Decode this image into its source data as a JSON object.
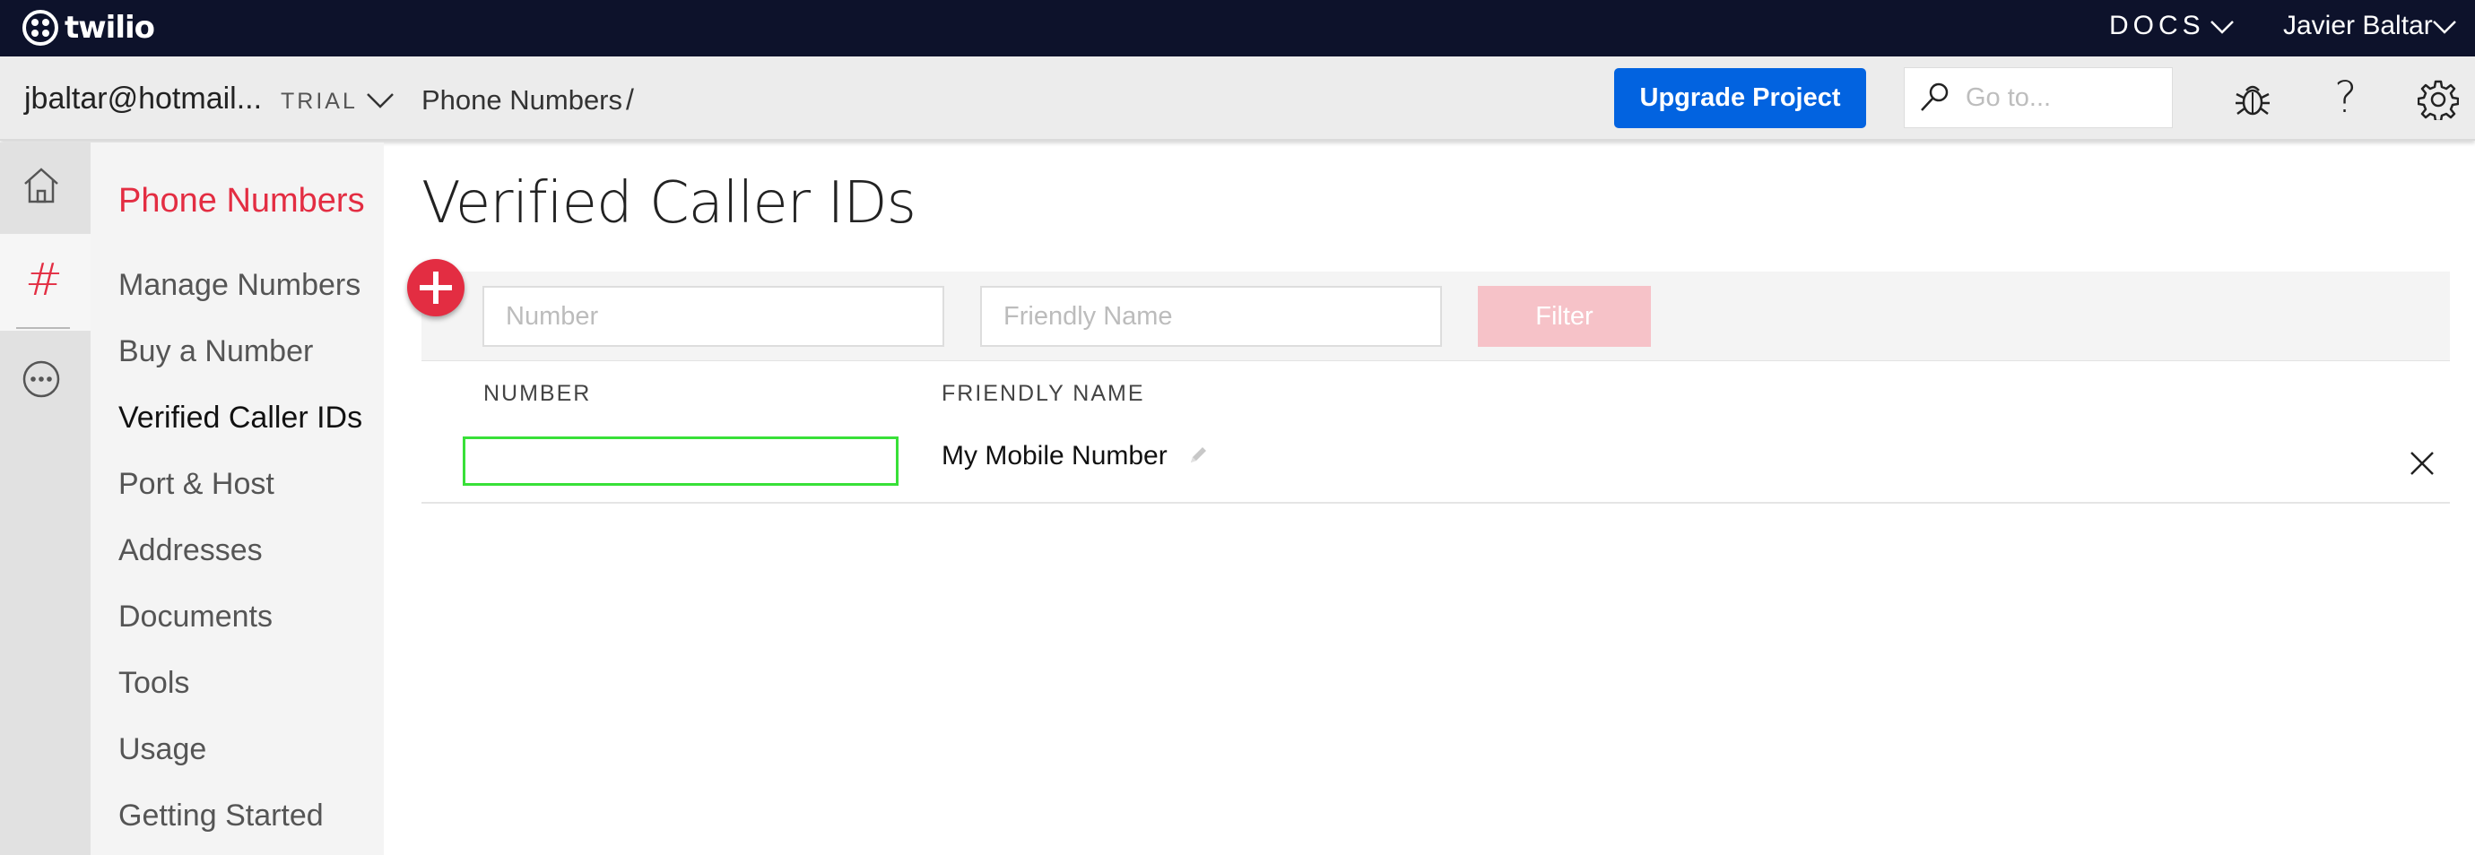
{
  "topbar": {
    "brand": "twilio",
    "docs_label": "DOCS",
    "user_name": "Javier Baltar"
  },
  "subbar": {
    "account": "jbaltar@hotmail...",
    "account_badge": "TRIAL",
    "breadcrumb": "Phone Numbers",
    "breadcrumb_separator": "/",
    "upgrade_label": "Upgrade Project",
    "goto_placeholder": "Go to..."
  },
  "rail": {
    "items": [
      "home-icon",
      "hash-icon",
      "more-icon"
    ],
    "hash_glyph": "#"
  },
  "sidebar": {
    "title": "Phone Numbers",
    "items": [
      {
        "label": "Manage Numbers"
      },
      {
        "label": "Buy a Number"
      },
      {
        "label": "Verified Caller IDs"
      },
      {
        "label": "Port & Host"
      },
      {
        "label": "Addresses"
      },
      {
        "label": "Documents"
      },
      {
        "label": "Tools"
      },
      {
        "label": "Usage"
      },
      {
        "label": "Getting Started"
      }
    ],
    "active_index": 2
  },
  "main": {
    "title": "Verified Caller IDs",
    "filter": {
      "number_placeholder": "Number",
      "friendly_placeholder": "Friendly Name",
      "button_label": "Filter"
    },
    "table": {
      "headers": [
        "NUMBER",
        "FRIENDLY NAME"
      ],
      "rows": [
        {
          "number": "",
          "friendly_name": "My Mobile Number"
        }
      ]
    }
  },
  "colors": {
    "brand_red": "#e32d42",
    "primary_blue": "#0263e0",
    "topbar_bg": "#0d122b",
    "filter_disabled": "#f6c2c8",
    "highlight_green": "#38e038"
  }
}
